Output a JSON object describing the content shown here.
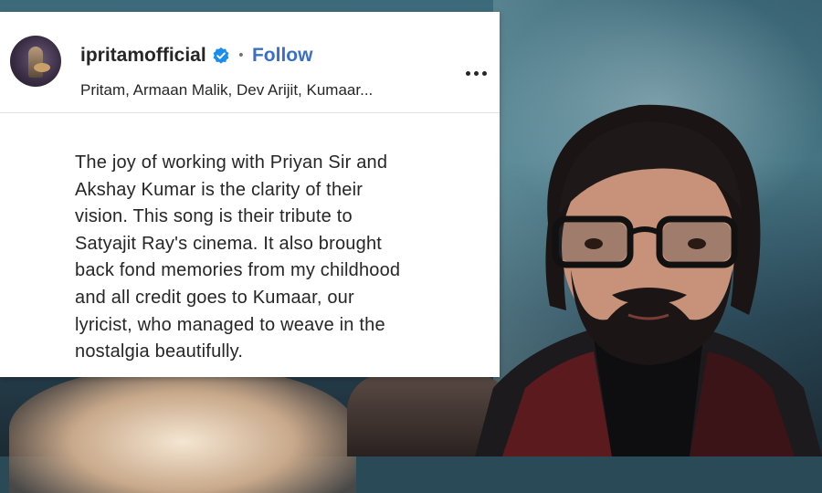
{
  "post": {
    "username": "ipritamofficial",
    "separator": "•",
    "follow_label": "Follow",
    "collaborators": "Pritam, Armaan Malik, Dev Arijit, Kumaar...",
    "caption_lines": [
      "The joy of working with Priyan Sir and",
      "Akshay Kumar is the clarity of their",
      "vision. This song is their tribute to",
      "Satyajit Ray's cinema. It also brought",
      "back fond memories from my childhood",
      "and all credit goes to Kumaar, our",
      "lyricist, who managed to weave in the",
      "nostalgia beautifully."
    ],
    "icons": {
      "verified": "verified-badge-icon",
      "more": "more-options-icon"
    }
  },
  "colors": {
    "follow": "#3a6fc8",
    "verified": "#1a8df0",
    "text": "#262626"
  }
}
